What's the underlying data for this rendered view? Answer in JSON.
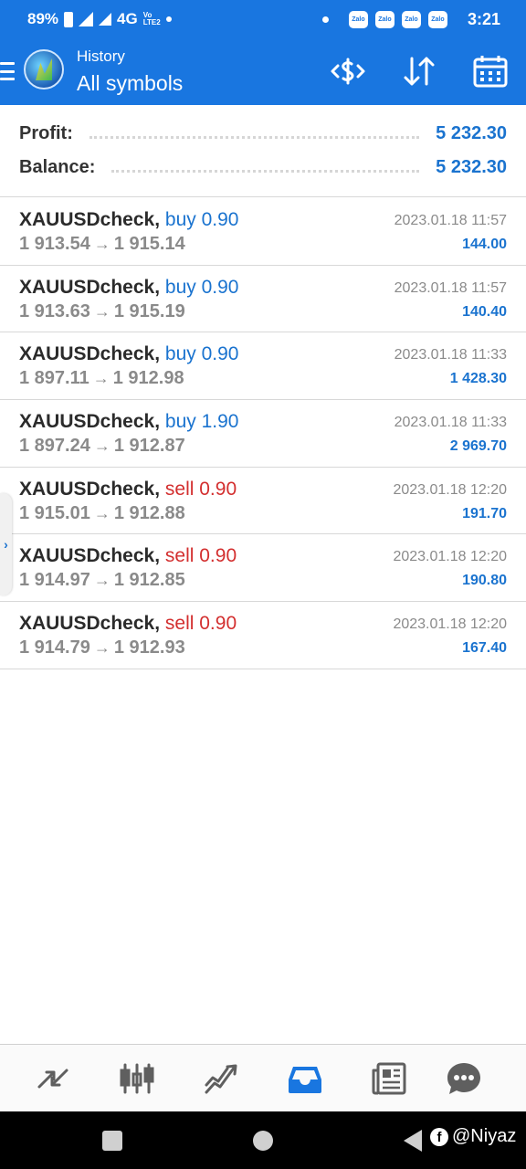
{
  "status_bar": {
    "battery": "89%",
    "network": "4G",
    "lte_top": "Vo",
    "lte_bottom": "LTE2",
    "zalo_label": "Zalo",
    "time": "3:21"
  },
  "header": {
    "subtitle": "History",
    "title": "All symbols",
    "icons": [
      "balance-operations-icon",
      "sort-icon",
      "calendar-icon"
    ]
  },
  "summary": {
    "profit_label": "Profit:",
    "profit_value": "5 232.30",
    "balance_label": "Balance:",
    "balance_value": "5 232.30"
  },
  "deals": [
    {
      "symbol": "XAUUSDcheck,",
      "type": "buy 0.90",
      "side": "buy",
      "open": "1 913.54",
      "close": "1 915.14",
      "arrow": "→",
      "time": "2023.01.18 11:57",
      "profit": "144.00"
    },
    {
      "symbol": "XAUUSDcheck,",
      "type": "buy 0.90",
      "side": "buy",
      "open": "1 913.63",
      "close": "1 915.19",
      "arrow": "→",
      "time": "2023.01.18 11:57",
      "profit": "140.40"
    },
    {
      "symbol": "XAUUSDcheck,",
      "type": "buy 0.90",
      "side": "buy",
      "open": "1 897.11",
      "close": "1 912.98",
      "arrow": "→",
      "time": "2023.01.18 11:33",
      "profit": "1 428.30"
    },
    {
      "symbol": "XAUUSDcheck,",
      "type": "buy 1.90",
      "side": "buy",
      "open": "1 897.24",
      "close": "1 912.87",
      "arrow": "→",
      "time": "2023.01.18 11:33",
      "profit": "2 969.70"
    },
    {
      "symbol": "XAUUSDcheck,",
      "type": "sell 0.90",
      "side": "sell",
      "open": "1 915.01",
      "close": "1 912.88",
      "arrow": "→",
      "time": "2023.01.18 12:20",
      "profit": "191.70"
    },
    {
      "symbol": "XAUUSDcheck,",
      "type": "sell 0.90",
      "side": "sell",
      "open": "1 914.97",
      "close": "1 912.85",
      "arrow": "→",
      "time": "2023.01.18 12:20",
      "profit": "190.80"
    },
    {
      "symbol": "XAUUSDcheck,",
      "type": "sell 0.90",
      "side": "sell",
      "open": "1 914.79",
      "close": "1 912.93",
      "arrow": "→",
      "time": "2023.01.18 12:20",
      "profit": "167.40"
    }
  ],
  "side_handle": "›",
  "tabs": [
    {
      "name": "quotes-icon",
      "active": false
    },
    {
      "name": "chart-icon",
      "active": false
    },
    {
      "name": "trade-icon",
      "active": false
    },
    {
      "name": "history-icon",
      "active": true
    },
    {
      "name": "news-icon",
      "active": false
    },
    {
      "name": "chat-icon",
      "active": false
    }
  ],
  "watermark": {
    "fb": "f",
    "handle": "@Niyaz"
  },
  "colors": {
    "accent": "#1976e0",
    "buy": "#1a73cf",
    "sell": "#d32f2f",
    "profit": "#1a73cf"
  }
}
